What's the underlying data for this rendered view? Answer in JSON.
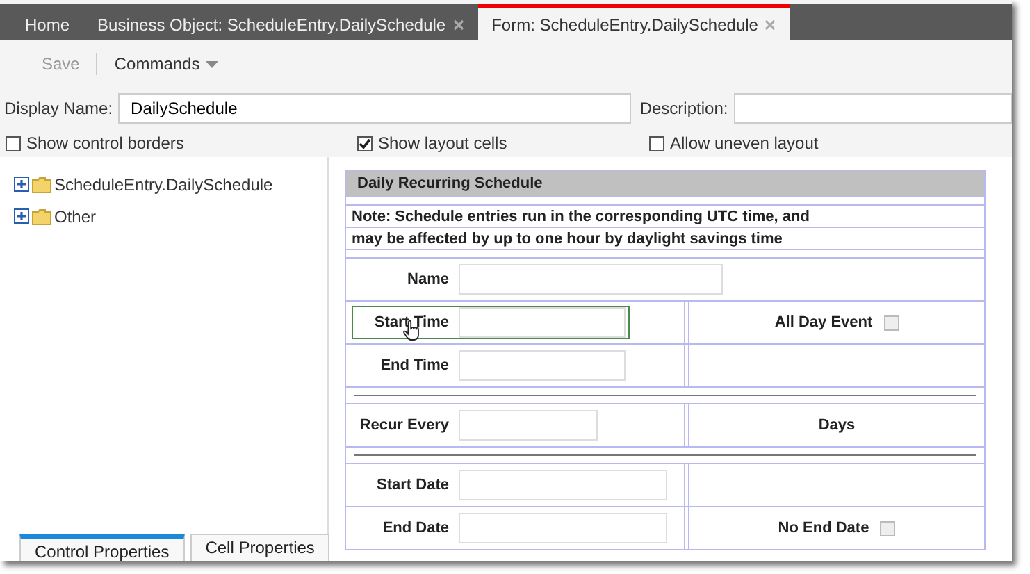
{
  "tabs": [
    {
      "label": "Home",
      "closable": false,
      "selected": false
    },
    {
      "label": "Business Object: ScheduleEntry.DailySchedule",
      "closable": true,
      "selected": false
    },
    {
      "label": "Form: ScheduleEntry.DailySchedule",
      "closable": true,
      "selected": true
    }
  ],
  "toolbar": {
    "save": {
      "label": "Save",
      "disabled": true
    },
    "commands": {
      "label": "Commands"
    }
  },
  "display_name": {
    "label": "Display Name:",
    "value": "DailySchedule"
  },
  "description": {
    "label": "Description:"
  },
  "options": [
    {
      "label": "Show control borders",
      "checked": false
    },
    {
      "label": "Show layout cells",
      "checked": true
    },
    {
      "label": "Allow uneven layout",
      "checked": false
    }
  ],
  "tree": {
    "items": [
      {
        "label": "ScheduleEntry.DailySchedule",
        "expanded": false
      },
      {
        "label": "Other",
        "expanded": false
      }
    ]
  },
  "bottom_tabs": [
    {
      "label": "Control Properties",
      "selected": true
    },
    {
      "label": "Cell Properties",
      "selected": false
    }
  ],
  "form": {
    "title": "Daily Recurring Schedule",
    "note": [
      "Note: Schedule entries run in the corresponding UTC time, and",
      "may be affected by up to one hour by daylight savings time"
    ],
    "rows": [
      {
        "kind": "field",
        "label": "Name",
        "selected": false
      },
      {
        "kind": "field",
        "label": "Start Time",
        "selected": true,
        "right": {
          "kind": "checkbox",
          "label": "All Day Event",
          "checked": false
        }
      },
      {
        "kind": "field",
        "label": "End Time",
        "selected": false,
        "right": {
          "kind": "blank"
        }
      },
      {
        "kind": "separator"
      },
      {
        "kind": "field",
        "label": "Recur Every",
        "selected": false,
        "right": {
          "kind": "text",
          "label": "Days"
        }
      },
      {
        "kind": "separator"
      },
      {
        "kind": "field",
        "label": "Start Date",
        "selected": false,
        "right": {
          "kind": "blank"
        }
      },
      {
        "kind": "field",
        "label": "End Date",
        "selected": false,
        "right": {
          "kind": "checkbox",
          "label": "No End Date",
          "checked": false
        }
      }
    ]
  }
}
